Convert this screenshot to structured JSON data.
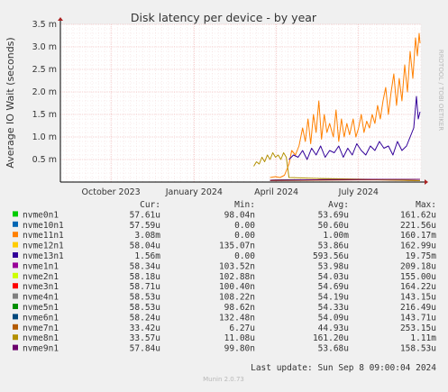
{
  "chart_data": {
    "type": "line",
    "title": "Disk latency per device - by year",
    "ylabel": "Average IO Wait (seconds)",
    "watermark": "RRDTOOL / TOBI OETIKER",
    "y_ticks": [
      {
        "value": 0.0005,
        "label": "0.5 m"
      },
      {
        "value": 0.001,
        "label": "1.0 m"
      },
      {
        "value": 0.0015,
        "label": "1.5 m"
      },
      {
        "value": 0.002,
        "label": "2.0 m"
      },
      {
        "value": 0.0025,
        "label": "2.5 m"
      },
      {
        "value": 0.003,
        "label": "3.0 m"
      },
      {
        "value": 0.0035,
        "label": "3.5 m"
      }
    ],
    "ylim": [
      0,
      0.0035
    ],
    "x_start": "2023-08-06",
    "x_end": "2024-09-08",
    "x_ticks": [
      {
        "date": "2023-10-01",
        "label": "October 2023"
      },
      {
        "date": "2024-01-01",
        "label": "January 2024"
      },
      {
        "date": "2024-04-01",
        "label": "April 2024"
      },
      {
        "date": "2024-07-01",
        "label": "July 2024"
      }
    ],
    "colors": {
      "background": "#f0f0f0",
      "plot_bg": "#ffffff",
      "grid": "#f0b0b0",
      "axis": "#000000",
      "zero_line": "#000000"
    },
    "legend_headers": [
      "Cur:",
      "Min:",
      "Avg:",
      "Max:"
    ],
    "series": [
      {
        "name": "nvme0n1",
        "color": "#00cc00",
        "cur": "57.61u",
        "min": "98.04n",
        "avg": "53.69u",
        "max": "161.62u",
        "points": [
          [
            "2024-03-25",
            4e-05
          ],
          [
            "2024-05-15",
            5e-05
          ],
          [
            "2024-07-15",
            6e-05
          ],
          [
            "2024-09-07",
            6e-05
          ]
        ]
      },
      {
        "name": "nvme10n1",
        "color": "#0066b3",
        "cur": "57.59u",
        "min": "0.00",
        "avg": "50.60u",
        "max": "221.56u",
        "points": [
          [
            "2024-03-25",
            4e-05
          ],
          [
            "2024-05-15",
            5e-05
          ],
          [
            "2024-07-15",
            6e-05
          ],
          [
            "2024-09-07",
            6e-05
          ]
        ]
      },
      {
        "name": "nvme11n1",
        "color": "#ff8000",
        "cur": "3.08m",
        "min": "0.00",
        "avg": "1.00m",
        "max": "160.17m",
        "points": [
          [
            "2024-03-25",
            0.0001
          ],
          [
            "2024-03-31",
            0.00012
          ],
          [
            "2024-04-05",
            0.0001
          ],
          [
            "2024-04-10",
            0.00015
          ],
          [
            "2024-04-15",
            0.0004
          ],
          [
            "2024-04-18",
            0.0007
          ],
          [
            "2024-04-22",
            0.0006
          ],
          [
            "2024-04-26",
            0.0008
          ],
          [
            "2024-04-30",
            0.0012
          ],
          [
            "2024-05-03",
            0.0009
          ],
          [
            "2024-05-06",
            0.0014
          ],
          [
            "2024-05-09",
            0.00085
          ],
          [
            "2024-05-12",
            0.0015
          ],
          [
            "2024-05-15",
            0.0011
          ],
          [
            "2024-05-18",
            0.0018
          ],
          [
            "2024-05-21",
            0.00095
          ],
          [
            "2024-05-24",
            0.0015
          ],
          [
            "2024-05-27",
            0.0011
          ],
          [
            "2024-05-30",
            0.0013
          ],
          [
            "2024-06-03",
            0.001
          ],
          [
            "2024-06-06",
            0.0016
          ],
          [
            "2024-06-09",
            0.0009
          ],
          [
            "2024-06-12",
            0.0014
          ],
          [
            "2024-06-15",
            0.001
          ],
          [
            "2024-06-18",
            0.0013
          ],
          [
            "2024-06-21",
            0.00105
          ],
          [
            "2024-06-25",
            0.0014
          ],
          [
            "2024-06-28",
            0.001
          ],
          [
            "2024-07-01",
            0.0012
          ],
          [
            "2024-07-04",
            0.0015
          ],
          [
            "2024-07-07",
            0.0011
          ],
          [
            "2024-07-10",
            0.00135
          ],
          [
            "2024-07-13",
            0.0012
          ],
          [
            "2024-07-16",
            0.0015
          ],
          [
            "2024-07-19",
            0.0013
          ],
          [
            "2024-07-22",
            0.0017
          ],
          [
            "2024-07-25",
            0.0014
          ],
          [
            "2024-07-28",
            0.0018
          ],
          [
            "2024-07-31",
            0.0021
          ],
          [
            "2024-08-03",
            0.0015
          ],
          [
            "2024-08-06",
            0.002
          ],
          [
            "2024-08-09",
            0.0024
          ],
          [
            "2024-08-12",
            0.0017
          ],
          [
            "2024-08-15",
            0.0023
          ],
          [
            "2024-08-18",
            0.0018
          ],
          [
            "2024-08-21",
            0.0026
          ],
          [
            "2024-08-24",
            0.002
          ],
          [
            "2024-08-27",
            0.0029
          ],
          [
            "2024-08-30",
            0.0023
          ],
          [
            "2024-09-02",
            0.0032
          ],
          [
            "2024-09-04",
            0.0028
          ],
          [
            "2024-09-06",
            0.0033
          ],
          [
            "2024-09-07",
            0.00308
          ]
        ]
      },
      {
        "name": "nvme12n1",
        "color": "#ffcc00",
        "cur": "58.04u",
        "min": "135.07n",
        "avg": "53.86u",
        "max": "162.99u",
        "points": [
          [
            "2024-03-25",
            4e-05
          ],
          [
            "2024-05-15",
            5e-05
          ],
          [
            "2024-07-15",
            6e-05
          ],
          [
            "2024-09-07",
            6e-05
          ]
        ]
      },
      {
        "name": "nvme13n1",
        "color": "#330099",
        "cur": "1.56m",
        "min": "0.00",
        "avg": "593.56u",
        "max": "19.75m",
        "points": [
          [
            "2024-04-15",
            0.0005
          ],
          [
            "2024-04-20",
            0.0006
          ],
          [
            "2024-04-25",
            0.00055
          ],
          [
            "2024-04-30",
            0.0007
          ],
          [
            "2024-05-05",
            0.0005
          ],
          [
            "2024-05-10",
            0.00075
          ],
          [
            "2024-05-15",
            0.0006
          ],
          [
            "2024-05-20",
            0.0008
          ],
          [
            "2024-05-25",
            0.00055
          ],
          [
            "2024-05-30",
            0.0007
          ],
          [
            "2024-06-04",
            0.00065
          ],
          [
            "2024-06-09",
            0.0008
          ],
          [
            "2024-06-14",
            0.00055
          ],
          [
            "2024-06-19",
            0.00075
          ],
          [
            "2024-06-24",
            0.0006
          ],
          [
            "2024-06-29",
            0.00085
          ],
          [
            "2024-07-04",
            0.0007
          ],
          [
            "2024-07-09",
            0.0006
          ],
          [
            "2024-07-14",
            0.0008
          ],
          [
            "2024-07-19",
            0.0007
          ],
          [
            "2024-07-24",
            0.0009
          ],
          [
            "2024-07-29",
            0.00075
          ],
          [
            "2024-08-03",
            0.0008
          ],
          [
            "2024-08-08",
            0.0006
          ],
          [
            "2024-08-13",
            0.0009
          ],
          [
            "2024-08-18",
            0.0007
          ],
          [
            "2024-08-23",
            0.0008
          ],
          [
            "2024-08-27",
            0.001
          ],
          [
            "2024-08-31",
            0.0012
          ],
          [
            "2024-09-03",
            0.0019
          ],
          [
            "2024-09-05",
            0.0014
          ],
          [
            "2024-09-07",
            0.00156
          ]
        ]
      },
      {
        "name": "nvme1n1",
        "color": "#990099",
        "cur": "58.34u",
        "min": "103.52n",
        "avg": "53.98u",
        "max": "209.18u",
        "points": [
          [
            "2024-03-25",
            4e-05
          ],
          [
            "2024-05-15",
            5e-05
          ],
          [
            "2024-07-15",
            6e-05
          ],
          [
            "2024-09-07",
            6e-05
          ]
        ]
      },
      {
        "name": "nvme2n1",
        "color": "#ccff00",
        "cur": "58.18u",
        "min": "102.88n",
        "avg": "54.03u",
        "max": "155.00u",
        "points": [
          [
            "2024-03-25",
            4e-05
          ],
          [
            "2024-05-15",
            5e-05
          ],
          [
            "2024-07-15",
            6e-05
          ],
          [
            "2024-09-07",
            6e-05
          ]
        ]
      },
      {
        "name": "nvme3n1",
        "color": "#ff0000",
        "cur": "58.71u",
        "min": "100.40n",
        "avg": "54.69u",
        "max": "164.22u",
        "points": [
          [
            "2024-03-25",
            4e-05
          ],
          [
            "2024-05-15",
            5e-05
          ],
          [
            "2024-07-15",
            6e-05
          ],
          [
            "2024-09-07",
            6e-05
          ]
        ]
      },
      {
        "name": "nvme4n1",
        "color": "#808080",
        "cur": "58.53u",
        "min": "108.22n",
        "avg": "54.19u",
        "max": "143.15u",
        "points": [
          [
            "2024-03-25",
            4e-05
          ],
          [
            "2024-05-15",
            5e-05
          ],
          [
            "2024-07-15",
            6e-05
          ],
          [
            "2024-09-07",
            6e-05
          ]
        ]
      },
      {
        "name": "nvme5n1",
        "color": "#008f00",
        "cur": "58.53u",
        "min": "98.62n",
        "avg": "54.33u",
        "max": "216.49u",
        "points": [
          [
            "2024-03-25",
            4e-05
          ],
          [
            "2024-05-15",
            5e-05
          ],
          [
            "2024-07-15",
            6e-05
          ],
          [
            "2024-09-07",
            6e-05
          ]
        ]
      },
      {
        "name": "nvme6n1",
        "color": "#00487d",
        "cur": "58.24u",
        "min": "132.48n",
        "avg": "54.09u",
        "max": "143.71u",
        "points": [
          [
            "2024-03-25",
            4e-05
          ],
          [
            "2024-05-15",
            5e-05
          ],
          [
            "2024-07-15",
            6e-05
          ],
          [
            "2024-09-07",
            6e-05
          ]
        ]
      },
      {
        "name": "nvme7n1",
        "color": "#b35a00",
        "cur": "33.42u",
        "min": "6.27u",
        "avg": "44.93u",
        "max": "253.15u",
        "points": [
          [
            "2024-03-25",
            3e-05
          ],
          [
            "2024-05-15",
            4e-05
          ],
          [
            "2024-07-15",
            5e-05
          ],
          [
            "2024-09-07",
            3e-05
          ]
        ]
      },
      {
        "name": "nvme8n1",
        "color": "#b38f00",
        "cur": "33.57u",
        "min": "11.08u",
        "avg": "161.20u",
        "max": "1.11m",
        "points": [
          [
            "2024-03-07",
            0.00035
          ],
          [
            "2024-03-10",
            0.00045
          ],
          [
            "2024-03-13",
            0.0004
          ],
          [
            "2024-03-16",
            0.00055
          ],
          [
            "2024-03-19",
            0.00045
          ],
          [
            "2024-03-22",
            0.0006
          ],
          [
            "2024-03-25",
            0.0005
          ],
          [
            "2024-03-28",
            0.00065
          ],
          [
            "2024-03-31",
            0.00055
          ],
          [
            "2024-04-03",
            0.0006
          ],
          [
            "2024-04-06",
            0.0005
          ],
          [
            "2024-04-09",
            0.00065
          ],
          [
            "2024-04-12",
            0.00055
          ],
          [
            "2024-04-15",
            0.0001
          ],
          [
            "2024-05-15",
            8e-05
          ],
          [
            "2024-07-15",
            6e-05
          ],
          [
            "2024-09-07",
            3e-05
          ]
        ]
      },
      {
        "name": "nvme9n1",
        "color": "#6b006b",
        "cur": "57.84u",
        "min": "99.80n",
        "avg": "53.68u",
        "max": "158.53u",
        "points": [
          [
            "2024-03-25",
            4e-05
          ],
          [
            "2024-05-15",
            5e-05
          ],
          [
            "2024-07-15",
            6e-05
          ],
          [
            "2024-09-07",
            6e-05
          ]
        ]
      }
    ]
  },
  "footer": {
    "last_update": "Last update: Sun Sep  8 09:00:04 2024",
    "munin": "Munin 2.0.73"
  }
}
